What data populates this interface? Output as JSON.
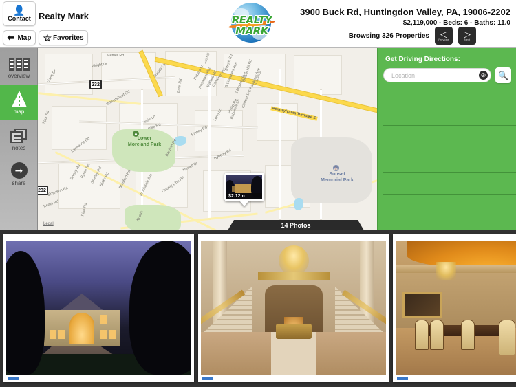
{
  "header": {
    "contact_label": "Contact",
    "contact_icon": "person-icon",
    "brand_name": "Realty Mark",
    "map_label": "Map",
    "map_icon": "back-arrow-icon",
    "favorites_label": "Favorites",
    "favorites_icon": "star-icon",
    "logo_line1": "REALTY",
    "logo_line2": "MARK",
    "address": "3900 Buck Rd, Huntingdon Valley, PA, 19006-2202",
    "details": "$2,119,000 · Beds: 6 · Baths: 11.0",
    "browsing": "Browsing 326 Properties",
    "prev_label": "Previous",
    "next_label": "Next",
    "prev_glyph": "◁",
    "next_glyph": "▷"
  },
  "sidebar": {
    "items": [
      {
        "id": "overview",
        "label": "overview",
        "icon": "overview-icon",
        "active": false
      },
      {
        "id": "map",
        "label": "map",
        "icon": "road-icon",
        "active": true
      },
      {
        "id": "notes",
        "label": "notes",
        "icon": "notes-icon",
        "active": false
      },
      {
        "id": "share",
        "label": "share",
        "icon": "share-arrow-icon",
        "active": false
      }
    ]
  },
  "map": {
    "legal_label": "Legal",
    "highway_shield": "232",
    "callout": {
      "price": "$2.12m",
      "thumb_alt": "property-exterior-thumbnail"
    },
    "photos_bar_label": "14 Photos",
    "parks": [
      {
        "name": "Lower\nMoreland Park",
        "line1": "Lower",
        "line2": "Moreland Park"
      },
      {
        "name": "Sunset Memorial Park",
        "line1": "Sunset",
        "line2": "Memorial Park"
      }
    ],
    "highway_label": "Pennsylvania Turnpike E",
    "streets": [
      "Mettler Rd",
      "Wright Dr",
      "Thrush Ln",
      "Robins Ln",
      "Gantt Dr",
      "Fairhill",
      "Elfreth Rd",
      "Gravel Hill Rd",
      "Killdeer Ln",
      "Bobwhite Ln",
      "Camelot",
      "Wheatsheaf Rd",
      "Spur Rd",
      "Oriole Ln",
      "Phillip Rd",
      "Long Ln",
      "Pinney Rd",
      "Baldwin Rd",
      "Byberry Rd",
      "Newell Dr",
      "Lawrence Rd",
      "Sidney Rd",
      "Byron Rd",
      "Shelley Rd",
      "Blake Rd",
      "Bradford Rd",
      "Brookdale Ave",
      "County Line Rd",
      "Emerson Rd",
      "Keats Rd",
      "Pine Rd",
      "Buck Rd",
      "Pike Rd",
      "Cameron Rd",
      "Pheasant Run",
      "Mallard Rd",
      "S Westview Ave",
      "S Midway Ave",
      "S Eastview Ave",
      "Woods"
    ]
  },
  "directions": {
    "title": "Get Driving Directions:",
    "input_value": "",
    "input_placeholder": "Location",
    "clear_icon": "clear-circle-icon",
    "search_icon": "search-icon",
    "row_count": 6
  },
  "photos": [
    {
      "id": 1,
      "alt": "mansion-exterior-at-dusk"
    },
    {
      "id": 2,
      "alt": "grand-foyer-double-staircase"
    },
    {
      "id": 3,
      "alt": "formal-dining-room"
    }
  ],
  "colors": {
    "accent_green": "#5cb850",
    "sidebar_active": "#52b74a",
    "strip_background": "#323232",
    "highway_yellow": "#fcd94c"
  }
}
